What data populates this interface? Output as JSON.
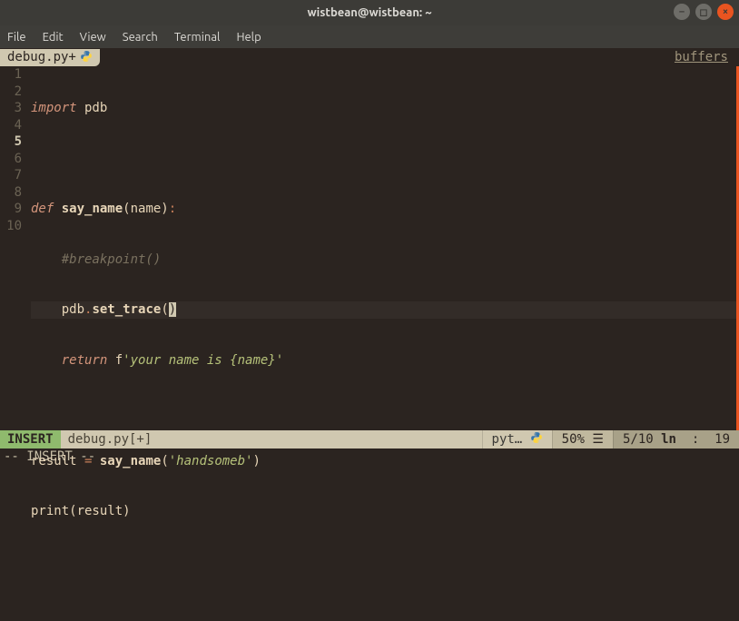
{
  "window": {
    "title": "wistbean@wistbean: ~"
  },
  "menu": {
    "file": "File",
    "edit": "Edit",
    "view": "View",
    "search": "Search",
    "terminal": "Terminal",
    "help": "Help"
  },
  "tab": {
    "label": "debug.py+",
    "buffers_label": "buffers"
  },
  "code": {
    "lines": {
      "l1_kw": "import",
      "l1_rest": " pdb",
      "l3_kw": "def",
      "l3_fn": " say_name",
      "l3_rest": "(name)",
      "l3_colon": ":",
      "l4_cmt": "    #breakpoint()",
      "l5_pre": "    pdb",
      "l5_dot": ".",
      "l5_fn": "set_trace",
      "l5_paren_open": "(",
      "l5_paren_close": ")",
      "l6_kw": "    return",
      "l6_str_pre": " f",
      "l6_str": "'your name is {name}'",
      "l8a": "result ",
      "l8_eq": "=",
      "l8_fn": " say_name",
      "l8_paren": "(",
      "l8_str": "'handsomeb'",
      "l8_paren2": ")",
      "l9a": "print(result)"
    },
    "line_numbers": [
      "1",
      "2",
      "3",
      "4",
      "5",
      "6",
      "7",
      "8",
      "9",
      "10"
    ],
    "cursor_line": 5
  },
  "status": {
    "mode": "INSERT",
    "file": "debug.py[+]",
    "filetype": "pyt…",
    "percent": "50%",
    "position": "5/10",
    "ln_label": "ln",
    "col": "19"
  },
  "cmdline": {
    "text": "-- INSERT --"
  }
}
